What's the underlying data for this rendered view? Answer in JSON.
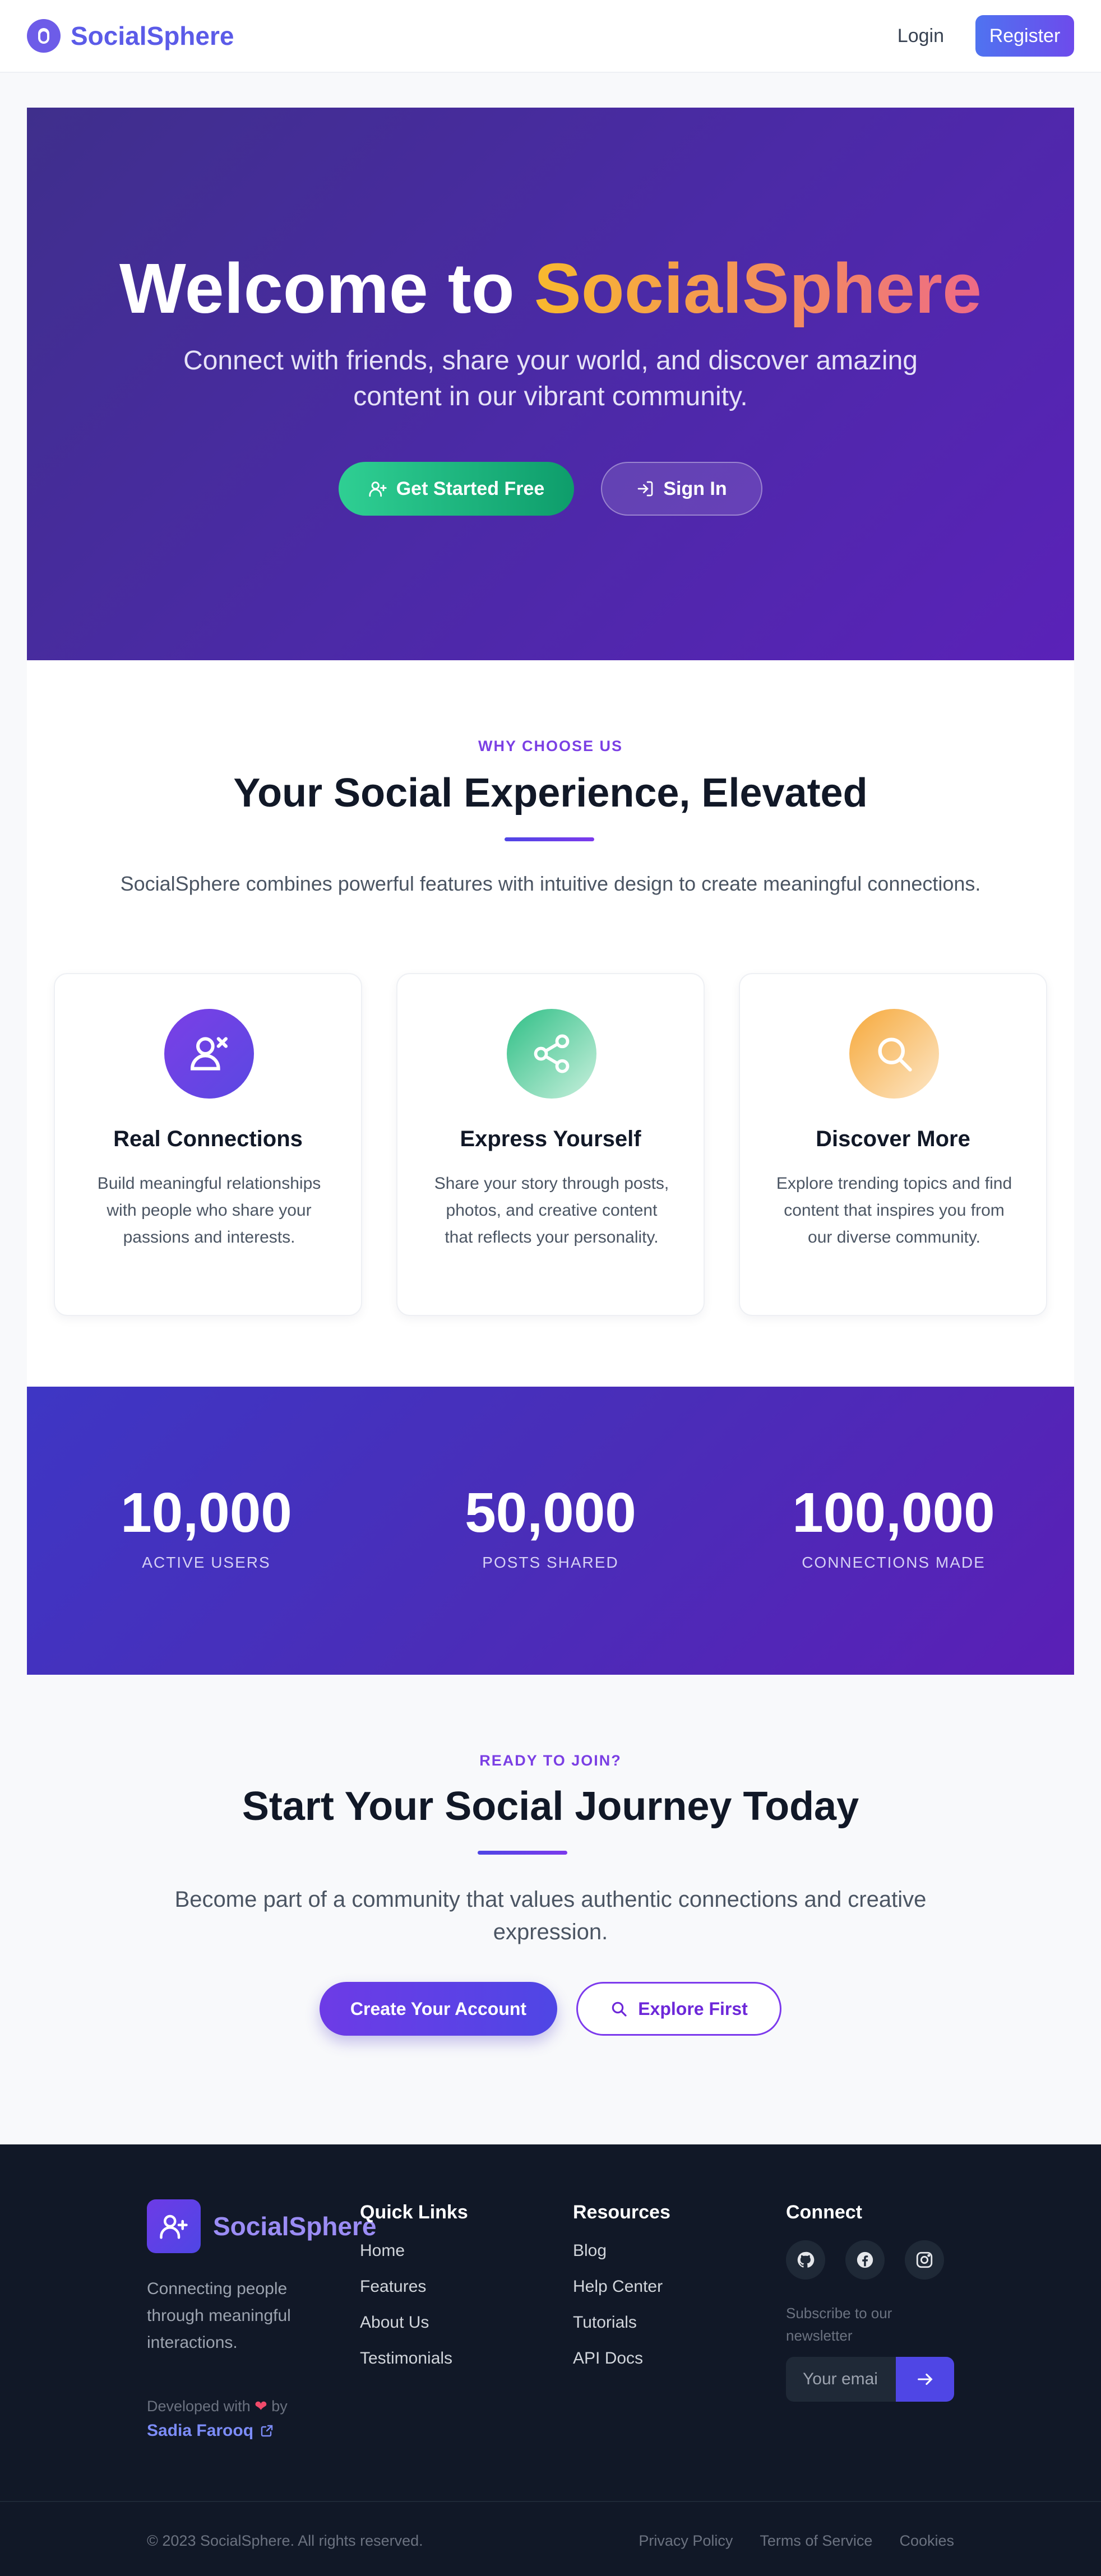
{
  "nav": {
    "brand": "SocialSphere",
    "login": "Login",
    "register": "Register"
  },
  "hero": {
    "title_prefix": "Welcome to ",
    "title_accent": "SocialSphere",
    "subtitle": "Connect with friends, share your world, and discover amazing content in our vibrant community.",
    "cta_primary": "Get Started Free",
    "cta_secondary": "Sign In"
  },
  "features": {
    "eyebrow": "WHY CHOOSE US",
    "title": "Your Social Experience, Elevated",
    "description": "SocialSphere combines powerful features with intuitive design to create meaningful connections.",
    "cards": [
      {
        "icon": "user-connections-icon",
        "title": "Real Connections",
        "description": "Build meaningful relationships with people who share your passions and interests.",
        "color": "#6d3be6"
      },
      {
        "icon": "share-icon",
        "title": "Express Yourself",
        "description": "Share your story through posts, photos, and creative content that reflects your personality.",
        "color": "#34c98e"
      },
      {
        "icon": "search-icon",
        "title": "Discover More",
        "description": "Explore trending topics and find content that inspires you from our diverse community.",
        "color": "#f6a93b"
      }
    ]
  },
  "stats": [
    {
      "value": "10,000",
      "label": "ACTIVE USERS"
    },
    {
      "value": "50,000",
      "label": "POSTS SHARED"
    },
    {
      "value": "100,000",
      "label": "CONNECTIONS MADE"
    }
  ],
  "cta": {
    "eyebrow": "READY TO JOIN?",
    "title": "Start Your Social Journey Today",
    "description": "Become part of a community that values authentic connections and creative expression.",
    "primary": "Create Your Account",
    "secondary": "Explore First"
  },
  "footer": {
    "brand": "SocialSphere",
    "tagline": "Connecting people through meaningful interactions.",
    "developed_with": "Developed with",
    "by": "by",
    "author": "Sadia Farooq",
    "quick_links": {
      "title": "Quick Links",
      "items": [
        "Home",
        "Features",
        "About Us",
        "Testimonials"
      ]
    },
    "resources": {
      "title": "Resources",
      "items": [
        "Blog",
        "Help Center",
        "Tutorials",
        "API Docs"
      ]
    },
    "connect": {
      "title": "Connect",
      "socials": [
        "github-icon",
        "facebook-icon",
        "instagram-icon"
      ],
      "newsletter_label": "Subscribe to our newsletter",
      "email_placeholder": "Your email"
    },
    "copyright": "© 2023 SocialSphere. All rights reserved.",
    "legal": [
      "Privacy Policy",
      "Terms of Service",
      "Cookies"
    ]
  },
  "colors": {
    "brand": "#5b5be8",
    "accent_gradient": [
      "#f8b92e",
      "#ee6a86"
    ],
    "hero_bg": "#4b2aa6",
    "footer_bg": "#111827"
  }
}
